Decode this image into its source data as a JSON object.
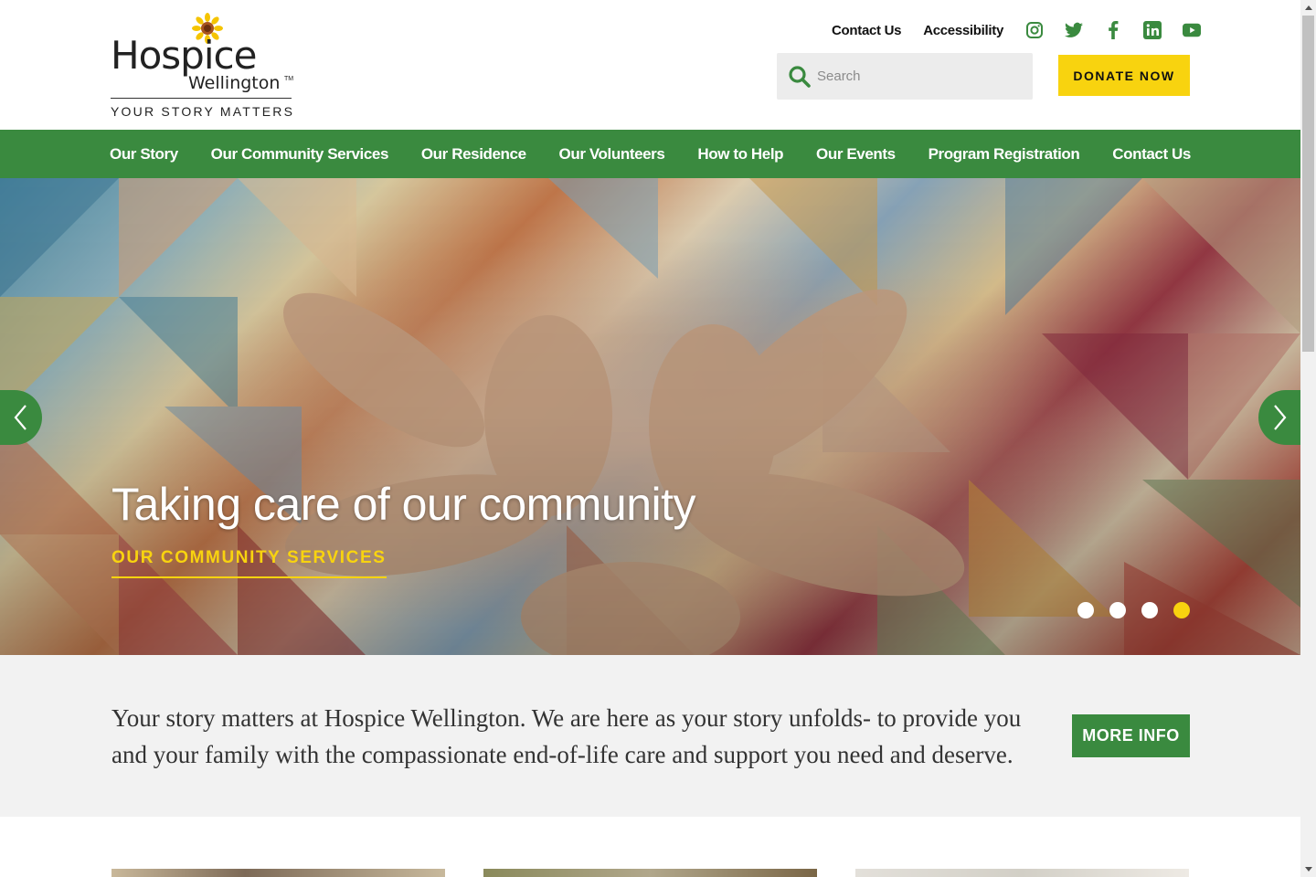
{
  "brand": {
    "name": "Hospice",
    "sub": "Wellington",
    "tm": "TM",
    "tagline": "YOUR STORY MATTERS"
  },
  "top_links": [
    {
      "label": "Contact Us"
    },
    {
      "label": "Accessibility"
    }
  ],
  "social": [
    "instagram-icon",
    "twitter-icon",
    "facebook-icon",
    "linkedin-icon",
    "youtube-icon"
  ],
  "search": {
    "placeholder": "Search"
  },
  "donate": {
    "label": "DONATE NOW"
  },
  "nav": [
    {
      "label": "Our Story"
    },
    {
      "label": "Our Community Services"
    },
    {
      "label": "Our Residence"
    },
    {
      "label": "Our Volunteers"
    },
    {
      "label": "How to Help"
    },
    {
      "label": "Our Events"
    },
    {
      "label": "Program Registration"
    },
    {
      "label": "Contact Us"
    }
  ],
  "hero": {
    "title": "Taking care of our community",
    "cta": "OUR COMMUNITY SERVICES",
    "slide_count": 4,
    "active_slide": 4
  },
  "intro": {
    "text": "Your story matters at Hospice Wellington. We are here as your story unfolds- to provide you and your family with the compassionate end-of-life care and support you need and deserve.",
    "button": "MORE INFO"
  },
  "colors": {
    "green": "#3a8a3f",
    "yellow": "#f8d30f",
    "intro_bg": "#f2f2f2"
  }
}
